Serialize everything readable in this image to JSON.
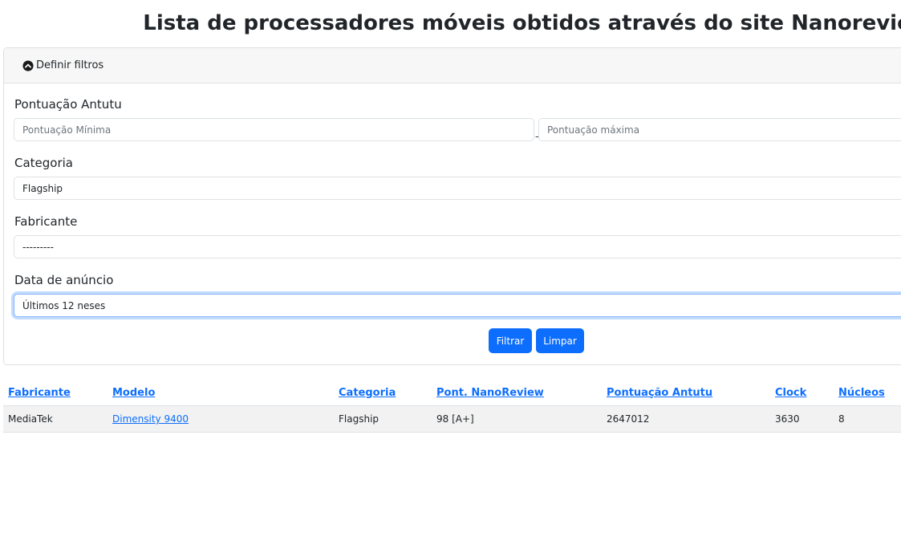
{
  "page": {
    "title": "Lista de processadores móveis obtidos através do site Nanoreview"
  },
  "filters": {
    "toggle_label": "Definir filtros",
    "antutu": {
      "label": "Pontuação Antutu",
      "min_placeholder": "Pontuação Mínima",
      "max_placeholder": "Pontuação máxima",
      "separator": "–"
    },
    "category": {
      "label": "Categoria",
      "value": "Flagship"
    },
    "manufacturer": {
      "label": "Fabricante",
      "value": "---------"
    },
    "announce_date": {
      "label": "Data de anúncio",
      "value": "Últimos 12 neses"
    },
    "filter_button": "Filtrar",
    "clear_button": "Limpar"
  },
  "table": {
    "columns": [
      "Fabricante",
      "Modelo",
      "Categoria",
      "Pont. NanoReview",
      "Pontuação Antutu",
      "Clock",
      "Núcleos"
    ],
    "rows": [
      [
        "MediaTek",
        "Dimensity 9400",
        "Flagship",
        "98 [A+]",
        "2647012",
        "3630",
        "8"
      ]
    ]
  },
  "colors": {
    "accent": "#0d6efd",
    "header_bg": "#f7f7f7",
    "row_bg": "#f2f2f2"
  }
}
